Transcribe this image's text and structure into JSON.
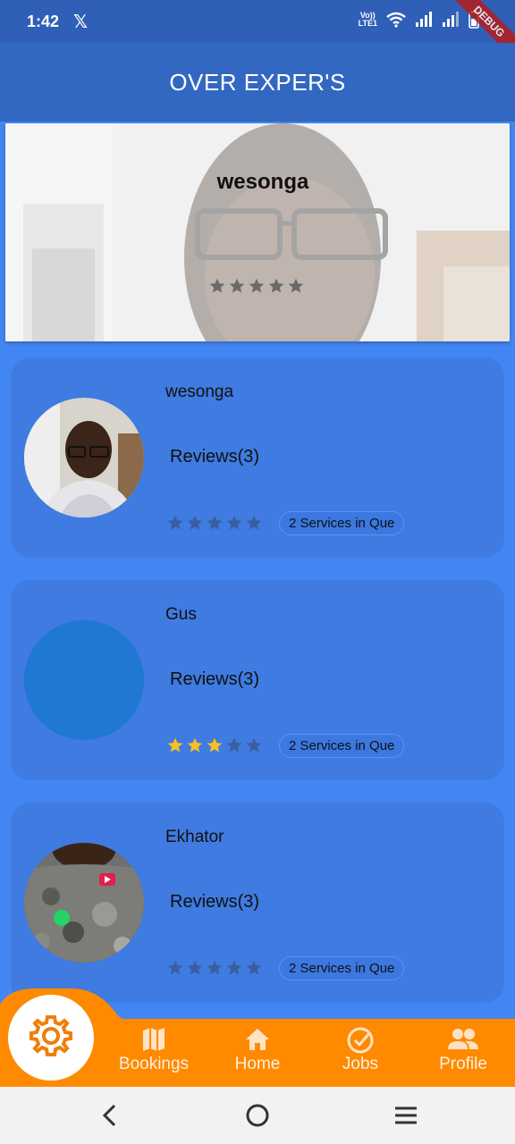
{
  "status_bar": {
    "time": "1:42",
    "notification_icon": "x-logo-icon",
    "volte_label_top": "Vo))",
    "volte_label_bottom": "LTE1",
    "debug_label": "DEBUG"
  },
  "app_bar": {
    "title": "OVER EXPER'S"
  },
  "featured": {
    "name": "wesonga",
    "rating": 0,
    "max_rating": 5
  },
  "experts": [
    {
      "name": "wesonga",
      "reviews_label": "Reviews(3)",
      "rating": 0,
      "max_rating": 5,
      "queue_label": "2 Services in Que",
      "avatar": "photo-man-glasses"
    },
    {
      "name": "Gus",
      "reviews_label": "Reviews(3)",
      "rating": 3,
      "max_rating": 5,
      "queue_label": "2 Services in Que",
      "avatar": "placeholder-circle"
    },
    {
      "name": "Ekhator",
      "reviews_label": "Reviews(3)",
      "rating": 0,
      "max_rating": 5,
      "queue_label": "2 Services in Que",
      "avatar": "photo-camo-shirt"
    }
  ],
  "bottom_nav": {
    "fab_icon": "gear-icon",
    "items": [
      {
        "label": "Bookings",
        "icon": "map-icon"
      },
      {
        "label": "Home",
        "icon": "home-icon"
      },
      {
        "label": "Jobs",
        "icon": "check-circle-icon"
      },
      {
        "label": "Profile",
        "icon": "people-icon"
      }
    ]
  },
  "colors": {
    "background": "#4286f4",
    "app_bar": "#3268c2",
    "card": "#3f7be0",
    "nav": "#ff8a00",
    "star_filled": "#f6c026",
    "star_empty": "#3a5fa0"
  }
}
